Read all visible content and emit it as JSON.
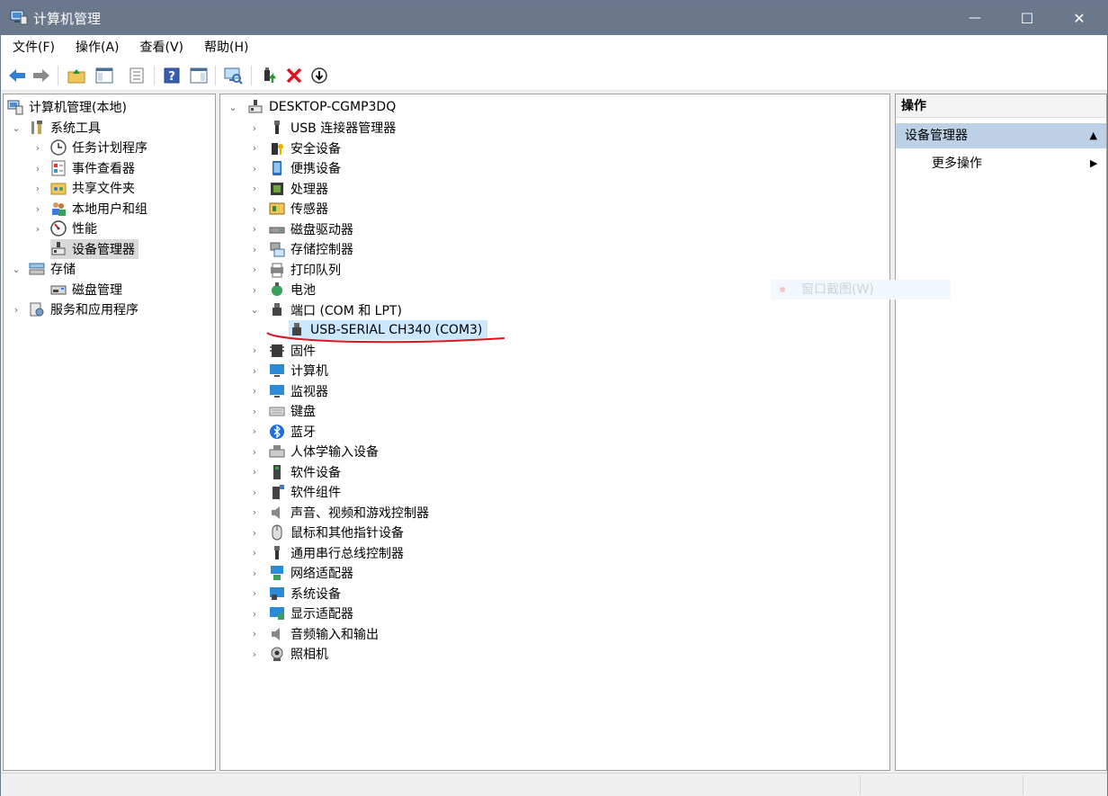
{
  "window": {
    "title": "计算机管理",
    "controls": {
      "minimize": "—",
      "maximize": "☐",
      "close": "✕"
    }
  },
  "menu": {
    "items": [
      {
        "label": "文件(F)"
      },
      {
        "label": "操作(A)"
      },
      {
        "label": "查看(V)"
      },
      {
        "label": "帮助(H)"
      }
    ]
  },
  "toolbar": {
    "icons": [
      "back-arrow-icon",
      "forward-arrow-icon",
      "up-folder-icon",
      "show-hide-tree-icon",
      "properties-icon",
      "help-icon",
      "action-pane-icon",
      "scan-hardware-icon",
      "update-driver-icon",
      "uninstall-icon",
      "disable-device-icon"
    ]
  },
  "tree": {
    "root": "计算机管理(本地)",
    "system_tools": "系统工具",
    "task_scheduler": "任务计划程序",
    "event_viewer": "事件查看器",
    "shared_folders": "共享文件夹",
    "local_users": "本地用户和组",
    "performance": "性能",
    "device_manager": "设备管理器",
    "storage": "存储",
    "disk_management": "磁盘管理",
    "services_apps": "服务和应用程序"
  },
  "devices": {
    "computer_name": "DESKTOP-CGMP3DQ",
    "categories": [
      {
        "label": "USB 连接器管理器"
      },
      {
        "label": "安全设备"
      },
      {
        "label": "便携设备"
      },
      {
        "label": "处理器"
      },
      {
        "label": "传感器"
      },
      {
        "label": "磁盘驱动器"
      },
      {
        "label": "存储控制器"
      },
      {
        "label": "打印队列"
      },
      {
        "label": "电池"
      },
      {
        "label": "端口 (COM 和 LPT)"
      },
      {
        "label": "固件"
      },
      {
        "label": "计算机"
      },
      {
        "label": "监视器"
      },
      {
        "label": "键盘"
      },
      {
        "label": "蓝牙"
      },
      {
        "label": "人体学输入设备"
      },
      {
        "label": "软件设备"
      },
      {
        "label": "软件组件"
      },
      {
        "label": "声音、视频和游戏控制器"
      },
      {
        "label": "鼠标和其他指针设备"
      },
      {
        "label": "通用串行总线控制器"
      },
      {
        "label": "网络适配器"
      },
      {
        "label": "系统设备"
      },
      {
        "label": "显示适配器"
      },
      {
        "label": "音频输入和输出"
      },
      {
        "label": "照相机"
      }
    ],
    "port_child": "USB-SERIAL CH340 (COM3)"
  },
  "actions": {
    "header": "操作",
    "section": "设备管理器",
    "more": "更多操作"
  },
  "ghost_tooltip": "窗口截图(W)",
  "colors": {
    "titlebar": "#6b788c",
    "selection_gray": "#d9d9d9",
    "selection_blue": "#cce8ff",
    "action_section": "#bcd0e6",
    "annotation_red": "#e0141e"
  }
}
